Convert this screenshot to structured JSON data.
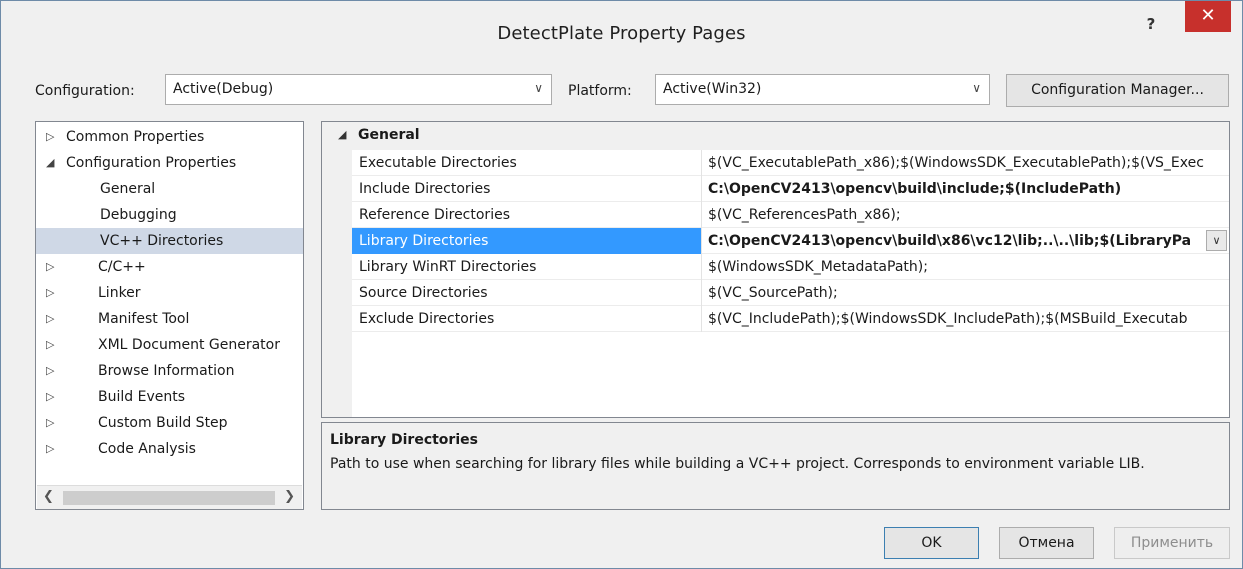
{
  "window": {
    "title": "DetectPlate Property Pages",
    "help_label": "?",
    "close_label": "✕"
  },
  "config": {
    "configuration_label": "Configuration:",
    "configuration_value": "Active(Debug)",
    "platform_label": "Platform:",
    "platform_value": "Active(Win32)",
    "manager_button": "Configuration Manager..."
  },
  "tree": {
    "items": [
      {
        "label": "Common Properties",
        "expander": "▷",
        "level": 0
      },
      {
        "label": "Configuration Properties",
        "expander": "◢",
        "level": 0
      },
      {
        "label": "General",
        "expander": "",
        "level": 1
      },
      {
        "label": "Debugging",
        "expander": "",
        "level": 1
      },
      {
        "label": "VC++ Directories",
        "expander": "",
        "level": 1,
        "selected": true
      },
      {
        "label": "C/C++",
        "expander": "▷",
        "level": 1
      },
      {
        "label": "Linker",
        "expander": "▷",
        "level": 1
      },
      {
        "label": "Manifest Tool",
        "expander": "▷",
        "level": 1
      },
      {
        "label": "XML Document Generator",
        "expander": "▷",
        "level": 1
      },
      {
        "label": "Browse Information",
        "expander": "▷",
        "level": 1
      },
      {
        "label": "Build Events",
        "expander": "▷",
        "level": 1
      },
      {
        "label": "Custom Build Step",
        "expander": "▷",
        "level": 1
      },
      {
        "label": "Code Analysis",
        "expander": "▷",
        "level": 1
      }
    ],
    "scroll_left": "❮",
    "scroll_right": "❯"
  },
  "grid": {
    "category": "General",
    "category_expander": "◢",
    "rows": [
      {
        "name": "Executable Directories",
        "value": "$(VC_ExecutablePath_x86);$(WindowsSDK_ExecutablePath);$(VS_Exec",
        "bold": false
      },
      {
        "name": "Include Directories",
        "value": "C:\\OpenCV2413\\opencv\\build\\include;$(IncludePath)",
        "bold": true
      },
      {
        "name": "Reference Directories",
        "value": "$(VC_ReferencesPath_x86);",
        "bold": false
      },
      {
        "name": "Library Directories",
        "value": "C:\\OpenCV2413\\opencv\\build\\x86\\vc12\\lib;..\\..\\lib;$(LibraryPa",
        "bold": true,
        "selected": true
      },
      {
        "name": "Library WinRT Directories",
        "value": "$(WindowsSDK_MetadataPath);",
        "bold": false
      },
      {
        "name": "Source Directories",
        "value": "$(VC_SourcePath);",
        "bold": false
      },
      {
        "name": "Exclude Directories",
        "value": "$(VC_IncludePath);$(WindowsSDK_IncludePath);$(MSBuild_Executab",
        "bold": false
      }
    ],
    "dropdown_glyph": "∨"
  },
  "description": {
    "title": "Library Directories",
    "text": "Path to use when searching for library files while building a VC++ project.  Corresponds to environment variable LIB."
  },
  "buttons": {
    "ok": "OK",
    "cancel": "Отмена",
    "apply": "Применить"
  },
  "colors": {
    "selection_blue": "#3399ff",
    "tree_selection": "#cfd8e6",
    "close_red": "#c7302c"
  }
}
